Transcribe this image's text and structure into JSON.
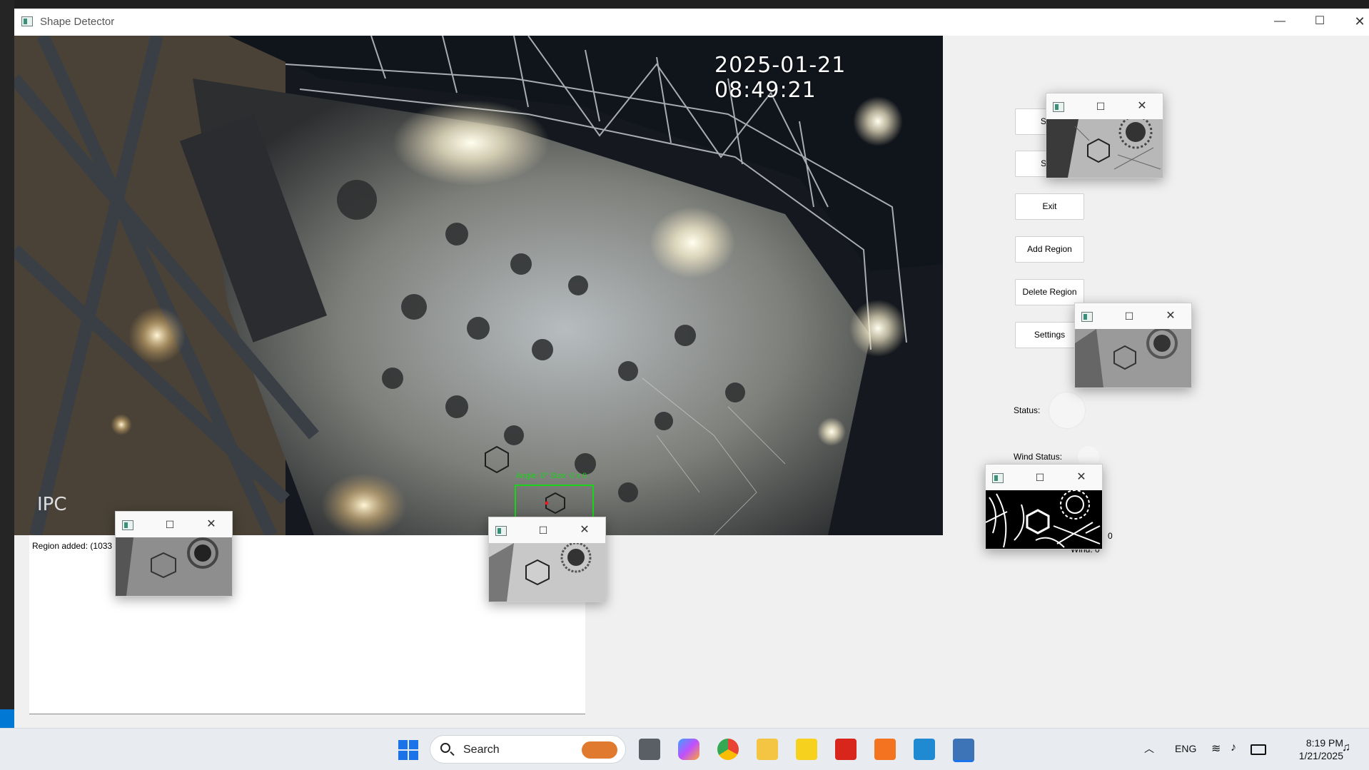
{
  "window": {
    "title": "Shape Detector",
    "minimize": "—",
    "maximize": "☐",
    "close": "✕"
  },
  "video": {
    "timestamp": "2025-01-21 08:49:21",
    "overlay_label": "IPC",
    "detection_label": "Angle: 0° Size: 0 x 0"
  },
  "log": {
    "text": "Region added: (1033"
  },
  "buttons": {
    "start": "Start",
    "stop": "Stop",
    "exit": "Exit",
    "add_region": "Add Region",
    "delete_region": "Delete Region",
    "settings": "Settings"
  },
  "status": {
    "status_label": "Status:",
    "wind_status_label": "Wind Status:",
    "count_value": "0",
    "wind_label": "Wind: 0"
  },
  "popups": {
    "max_glyph": "☐",
    "close_glyph": "✕"
  },
  "taskbar": {
    "search_placeholder": "Search",
    "language": "ENG",
    "time": "8:19 PM",
    "date": "1/21/2025"
  }
}
